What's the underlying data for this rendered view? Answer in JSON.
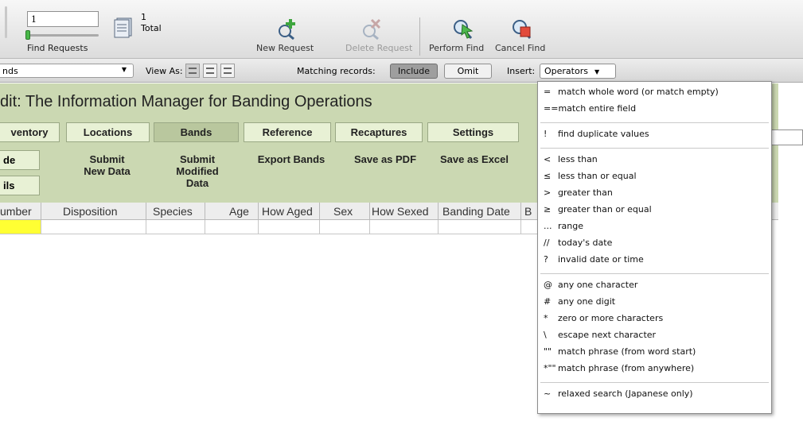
{
  "toolbar": {
    "record_input_value": "1",
    "find_requests_label": "Find Requests",
    "total_count": "1",
    "total_label": "Total",
    "new_request": "New Request",
    "delete_request": "Delete Request",
    "perform_find": "Perform Find",
    "cancel_find": "Cancel Find"
  },
  "findbar": {
    "layout_value": "nds",
    "view_as_label": "View As:",
    "matching_label": "Matching records:",
    "include_label": "Include",
    "omit_label": "Omit",
    "insert_label": "Insert:",
    "operators_label": "Operators"
  },
  "layout": {
    "title": "dit: The Information Manager for Banding Operations",
    "tabs": [
      {
        "label": "ventory"
      },
      {
        "label": "Locations"
      },
      {
        "label": "Bands"
      },
      {
        "label": "Reference"
      },
      {
        "label": "Recaptures"
      },
      {
        "label": "Settings"
      }
    ],
    "side_buttons": [
      "de",
      "ils"
    ],
    "actions": {
      "submit_new_line1": "Submit",
      "submit_new_line2": "New Data",
      "submit_mod_line1": "Submit",
      "submit_mod_line2": "Modified",
      "submit_mod_line3": "Data",
      "export_bands": "Export Bands",
      "save_pdf": "Save as PDF",
      "save_excel": "Save as Excel"
    },
    "columns": [
      "umber",
      "Disposition",
      "Species",
      "Age",
      "How Aged",
      "Sex",
      "How Sexed",
      "Banding Date",
      "B"
    ]
  },
  "operators_menu": {
    "groups": [
      [
        {
          "sym": "=",
          "text": "match whole word (or match empty)"
        },
        {
          "sym": "==",
          "text": "match entire field"
        }
      ],
      [
        {
          "sym": "!",
          "text": "find duplicate values"
        }
      ],
      [
        {
          "sym": "<",
          "text": "less than"
        },
        {
          "sym": "≤",
          "text": "less than or equal"
        },
        {
          "sym": ">",
          "text": "greater than"
        },
        {
          "sym": "≥",
          "text": "greater than or equal"
        },
        {
          "sym": "...",
          "text": "range"
        },
        {
          "sym": "//",
          "text": "today's date"
        },
        {
          "sym": "?",
          "text": "invalid date or time"
        }
      ],
      [
        {
          "sym": "@",
          "text": "any one character"
        },
        {
          "sym": "#",
          "text": "any one digit"
        },
        {
          "sym": "*",
          "text": "zero or more characters"
        },
        {
          "sym": "\\",
          "text": "escape next character"
        },
        {
          "sym": "\"\"",
          "text": "match phrase (from word start)"
        },
        {
          "sym": "*\"\"",
          "text": "match phrase (from anywhere)"
        }
      ],
      [
        {
          "sym": "~",
          "text": "relaxed search (Japanese only)"
        }
      ]
    ]
  }
}
